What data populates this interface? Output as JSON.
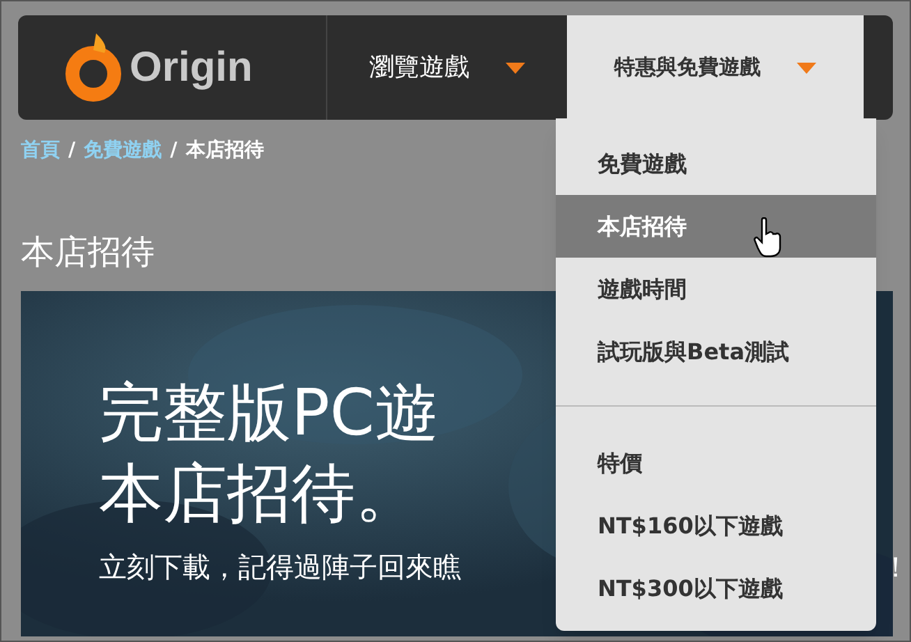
{
  "logo": {
    "text": "Origin"
  },
  "nav": [
    {
      "label": "瀏覽遊戲",
      "selected": false
    },
    {
      "label": "特惠與免費遊戲",
      "selected": true
    }
  ],
  "breadcrumb": [
    {
      "label": "首頁",
      "kind": "link"
    },
    {
      "label": "/",
      "kind": "separator"
    },
    {
      "label": "免費遊戲",
      "kind": "link"
    },
    {
      "label": "/",
      "kind": "separator"
    },
    {
      "label": "本店招待",
      "kind": "current"
    }
  ],
  "page_title": "本店招待",
  "hero": {
    "lines": [
      "完整版PC遊",
      "本店招待。"
    ],
    "subtitle": "立刻下載，記得過陣子回來瞧",
    "trailing": "！"
  },
  "dropdown": {
    "groups": [
      {
        "items": [
          {
            "label": "免費遊戲",
            "selected": false
          },
          {
            "label": "本店招待",
            "selected": true
          },
          {
            "label": "遊戲時間",
            "selected": false
          },
          {
            "label": "試玩版與Beta測試",
            "selected": false
          }
        ]
      },
      {
        "items": [
          {
            "label": "特價",
            "selected": false
          },
          {
            "label": "NT$160以下遊戲",
            "selected": false
          },
          {
            "label": "NT$300以下遊戲",
            "selected": false
          }
        ]
      }
    ]
  }
}
